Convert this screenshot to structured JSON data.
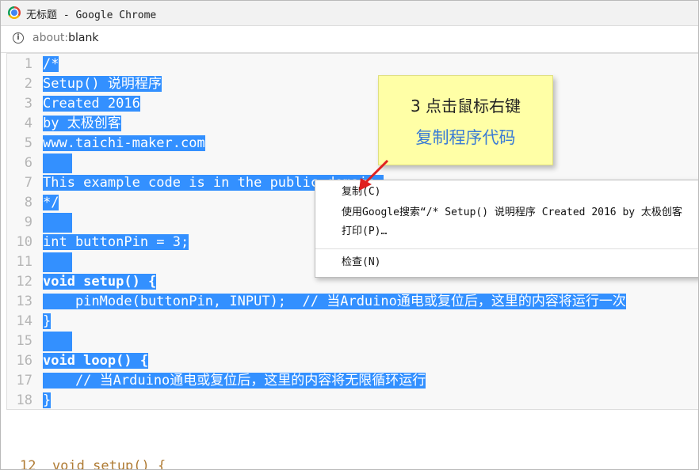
{
  "window": {
    "title": "无标题 - Google Chrome"
  },
  "address_bar": {
    "scheme": "about:",
    "path": "blank"
  },
  "editor": {
    "line_numbers": [
      "1",
      "2",
      "3",
      "4",
      "5",
      "6",
      "7",
      "8",
      "9",
      "10",
      "11",
      "12",
      "13",
      "14",
      "15",
      "16",
      "17",
      "18"
    ],
    "lines": [
      "/*",
      "Setup() 说明程序",
      "Created 2016",
      "by 太极创客",
      "www.taichi-maker.com",
      "",
      "This example code is in the public domain.",
      "*/",
      "",
      "int buttonPin = 3;",
      "",
      "void setup() {",
      "    pinMode(buttonPin, INPUT);  // 当Arduino通电或复位后，这里的内容将运行一次",
      "}",
      "",
      "void loop() {",
      "    // 当Arduino通电或复位后，这里的内容将无限循环运行",
      "}"
    ]
  },
  "background_text": "12  void setup() {",
  "callout": {
    "line1": "3 点击鼠标右键",
    "line2": "复制程序代码",
    "line2_color": "#3a7bd5"
  },
  "context_menu": {
    "items": [
      "复制(C)",
      "使用Google搜索“/* Setup() 说明程序 Created 2016 by 太极创客",
      "打印(P)…",
      "检查(N)"
    ]
  },
  "colors": {
    "selection": "#3390ff",
    "arrow": "#e02020"
  }
}
